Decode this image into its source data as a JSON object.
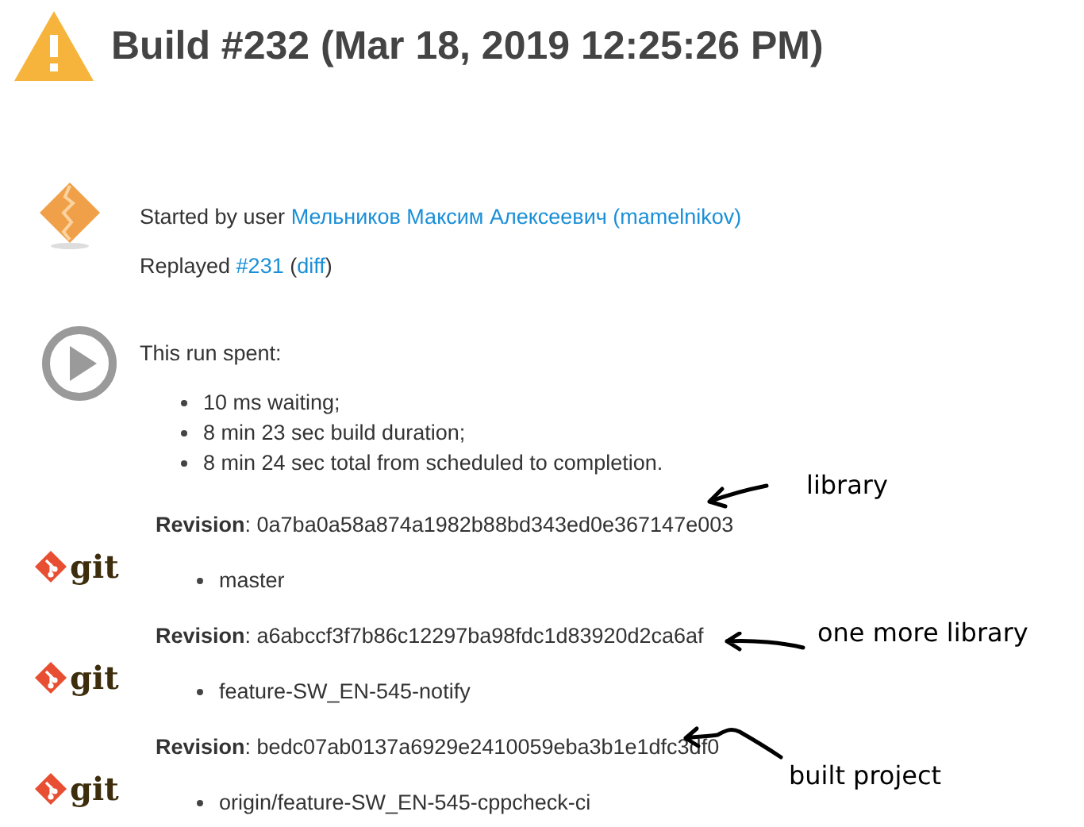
{
  "header": {
    "title": "Build #232 (Mar 18, 2019 12:25:26 PM)"
  },
  "cause": {
    "lines": [
      [
        {
          "kind": "text",
          "text": "Started by user "
        },
        {
          "kind": "link",
          "text": "Мельников Максим Алексеевич (mamelnikov)"
        }
      ],
      [
        {
          "kind": "text",
          "text": "Replayed "
        },
        {
          "kind": "link",
          "text": "#231"
        },
        {
          "kind": "text",
          "text": " ("
        },
        {
          "kind": "link",
          "text": "diff"
        },
        {
          "kind": "text",
          "text": ")"
        }
      ]
    ]
  },
  "timing": {
    "title": "This run spent:",
    "items": [
      "10 ms waiting;",
      "8 min 23 sec build duration;",
      "8 min 24 sec total from scheduled to completion."
    ]
  },
  "revisions": [
    {
      "logo_text": "git",
      "revision": "**Revision**: 0a7ba0a58a874a1982b88bd343ed0e367147e003",
      "branches": [
        "master"
      ]
    },
    {
      "logo_text": "git",
      "revision": "**Revision**: a6abccf3f7b86c12297ba98fdc1d83920d2ca6af",
      "branches": [
        "feature-SW_EN-545-notify"
      ]
    },
    {
      "logo_text": "git",
      "revision": "**Revision**: bedc07ab0137a6929e2410059eba3b1e1dfc3df0",
      "branches": [
        "origin/feature-SW_EN-545-cppcheck-ci"
      ]
    }
  ],
  "annotations": [
    {
      "text": "library"
    },
    {
      "text": "one more library"
    },
    {
      "text": "built project"
    }
  ]
}
